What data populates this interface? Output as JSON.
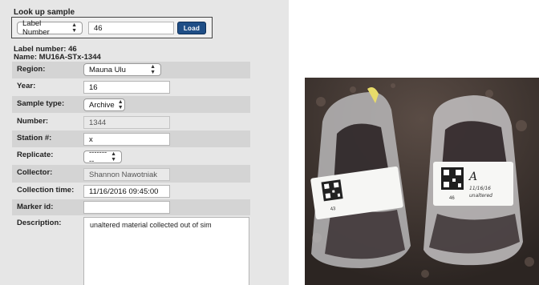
{
  "lookup": {
    "title": "Look up sample",
    "type_select": "Label Number",
    "value": "46",
    "load_button": "Load"
  },
  "sample": {
    "label_number_line": "Label number: 46",
    "name_line": "Name: MU16A-STx-1344"
  },
  "fields": {
    "region": {
      "label": "Region:",
      "value": "Mauna Ulu"
    },
    "year": {
      "label": "Year:",
      "value": "16"
    },
    "sample_type": {
      "label": "Sample type:",
      "value": "Archive"
    },
    "number": {
      "label": "Number:",
      "value": "1344"
    },
    "station": {
      "label": "Station #:",
      "value": "x"
    },
    "replicate": {
      "label": "Replicate:",
      "value": "---------"
    },
    "collector": {
      "label": "Collector:",
      "value": "Shannon Nawotniak"
    },
    "collection_time": {
      "label": "Collection time:",
      "value": "11/16/2016 09:45:00"
    },
    "marker_id": {
      "label": "Marker id:",
      "value": ""
    },
    "description": {
      "label": "Description:",
      "value": "unaltered material collected out of sim"
    }
  },
  "photo": {
    "left_label_number": "43",
    "right_label_number": "46",
    "right_label_letter": "A",
    "right_label_note1": "11/16/16",
    "right_label_note2": "unaltered"
  }
}
